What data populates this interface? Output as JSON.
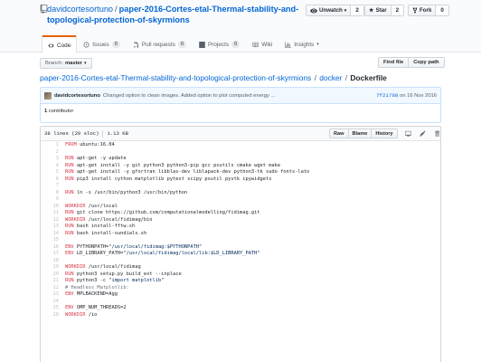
{
  "repo": {
    "owner": "davidcortesortuno",
    "name_line1": "paper-2016-Cortes-etal-Thermal-stability-and-",
    "name_line2": "topological-protection-of-skyrmions"
  },
  "social": {
    "watch_label": "Unwatch",
    "watch_count": "2",
    "star_label": "Star",
    "star_count": "2",
    "fork_label": "Fork",
    "fork_count": "0"
  },
  "tabs": [
    {
      "label": "Code",
      "icon": "code-icon"
    },
    {
      "label": "Issues",
      "count": "0",
      "icon": "issue-icon"
    },
    {
      "label": "Pull requests",
      "count": "0",
      "icon": "pull-request-icon"
    },
    {
      "label": "Projects",
      "count": "0",
      "icon": "project-icon"
    },
    {
      "label": "Wiki",
      "icon": "book-icon"
    },
    {
      "label": "Insights",
      "icon": "graph-icon"
    }
  ],
  "branch": {
    "label": "Branch:",
    "value": "master"
  },
  "file_nav": {
    "find_file": "Find file",
    "copy_path": "Copy path"
  },
  "breadcrumb": {
    "repo": "paper-2016-Cortes-etal-Thermal-stability-and-topological-protection-of-skyrmions",
    "dir": "docker",
    "file": "Dockerfile",
    "separator": "/"
  },
  "commit": {
    "author": "davidcortesortuno",
    "message": "Changed option to clean images. Added option to plot computed energy ...",
    "sha": "7f21768",
    "date_prefix": "on",
    "date": "16 Nov 2016"
  },
  "contributors": {
    "count": "1",
    "label": "contributor"
  },
  "file": {
    "lines": "38 lines (29 sloc)",
    "size": "1.13 KB",
    "raw": "Raw",
    "blame": "Blame",
    "history": "History"
  },
  "code_lines": [
    [
      {
        "t": "FROM",
        "c": "kw"
      },
      {
        "t": " ubuntu:16.04"
      }
    ],
    [],
    [
      {
        "t": "RUN",
        "c": "kw"
      },
      {
        "t": " apt-get -y update"
      }
    ],
    [
      {
        "t": "RUN",
        "c": "kw"
      },
      {
        "t": " apt-get install -y git python3 python3-pip gcc psutils cmake wget make"
      }
    ],
    [
      {
        "t": "RUN",
        "c": "kw"
      },
      {
        "t": " apt-get install -y gfortran libblas-dev liblapack-dev python3-tk sudo fonts-lato"
      }
    ],
    [
      {
        "t": "RUN",
        "c": "kw"
      },
      {
        "t": " pip3 install cython matplotlib pytest scipy psutil pyvtk ipywidgets"
      }
    ],
    [],
    [
      {
        "t": "RUN",
        "c": "kw"
      },
      {
        "t": " ln -s /usr/bin/python3 /usr/bin/python"
      }
    ],
    [],
    [
      {
        "t": "WORKDIR",
        "c": "kw"
      },
      {
        "t": " /usr/local"
      }
    ],
    [
      {
        "t": "RUN",
        "c": "kw"
      },
      {
        "t": " git clone https://github.com/computationalmodelling/fidimag.git"
      }
    ],
    [
      {
        "t": "WORKDIR",
        "c": "kw"
      },
      {
        "t": " /usr/local/fidimag/bin"
      }
    ],
    [
      {
        "t": "RUN",
        "c": "kw"
      },
      {
        "t": " bash install-fftw.sh"
      }
    ],
    [
      {
        "t": "RUN",
        "c": "kw"
      },
      {
        "t": " bash install-sundials.sh"
      }
    ],
    [],
    [
      {
        "t": "ENV",
        "c": "kw"
      },
      {
        "t": " PYTHONPATH="
      },
      {
        "t": "\"/usr/local/fidimag:$PYTHONPATH\"",
        "c": "str"
      }
    ],
    [
      {
        "t": "ENV",
        "c": "kw"
      },
      {
        "t": " LD_LIBRARY_PATH="
      },
      {
        "t": "\"/usr/local/fidimag/local/lib:$LD_LIBRARY_PATH\"",
        "c": "str"
      }
    ],
    [],
    [
      {
        "t": "WORKDIR",
        "c": "kw"
      },
      {
        "t": " /usr/local/fidimag"
      }
    ],
    [
      {
        "t": "RUN",
        "c": "kw"
      },
      {
        "t": " python3 setup.py build_ext --inplace"
      }
    ],
    [
      {
        "t": "RUN",
        "c": "kw"
      },
      {
        "t": " python3 -c "
      },
      {
        "t": "\"import matplotlib\"",
        "c": "str"
      }
    ],
    [
      {
        "t": "# Headless Matplotlib:",
        "c": "cmt"
      }
    ],
    [
      {
        "t": "ENV",
        "c": "kw"
      },
      {
        "t": " MPLBACKEND=Agg"
      }
    ],
    [],
    [
      {
        "t": "ENV",
        "c": "kw"
      },
      {
        "t": " OMP_NUM_THREADS=2"
      }
    ],
    [
      {
        "t": "WORKDIR",
        "c": "kw"
      },
      {
        "t": " /io"
      }
    ]
  ]
}
